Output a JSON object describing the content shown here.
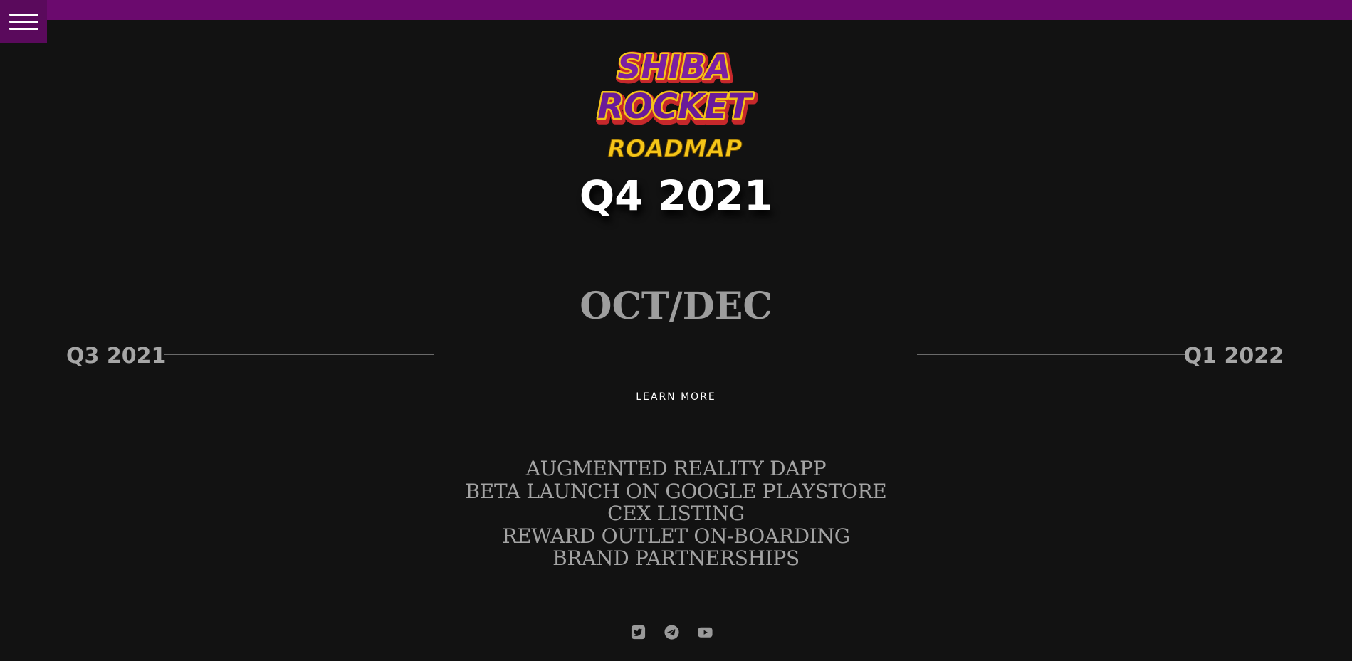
{
  "header": {
    "menu_icon": "hamburger-menu-icon",
    "top_bar_color": "#6b0a6e",
    "menu_button_color": "#5a0a5c"
  },
  "logo": {
    "line1": "SHIBA",
    "line2": "ROCKET",
    "line3": "ROADMAP",
    "colors": {
      "purple": "#6a1b9a",
      "gold": "#f5c518",
      "red": "#c6282b"
    }
  },
  "roadmap": {
    "quarter": "Q4 2021",
    "period": "OCT/DEC",
    "prev_label": "Q3 2021",
    "next_label": "Q1 2022",
    "learn_more_label": "LEARN MORE",
    "items": [
      "AUGMENTED REALITY DAPP",
      "BETA LAUNCH ON GOOGLE PLAYSTORE",
      "CEX LISTING",
      "REWARD OUTLET ON-BOARDING",
      "BRAND PARTNERSHIPS"
    ]
  },
  "social": {
    "icons": [
      "twitter-icon",
      "telegram-icon",
      "youtube-icon"
    ],
    "color": "#9a9a9a"
  }
}
